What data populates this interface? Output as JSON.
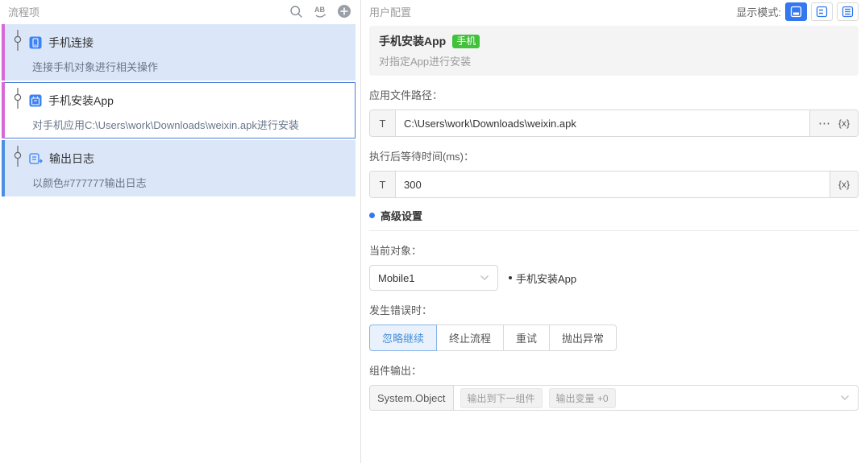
{
  "left_panel": {
    "title": "流程项",
    "items": [
      {
        "title": "手机连接",
        "desc": "连接手机对象进行相关操作",
        "bar_color": "#d46ad8",
        "selected": false
      },
      {
        "title": "手机安装App",
        "desc": "对手机应用C:\\Users\\work\\Downloads\\weixin.apk进行安装",
        "bar_color": "#d46ad8",
        "selected": true
      },
      {
        "title": "输出日志",
        "desc": "以颜色#777777输出日志",
        "bar_color": "#4a90e2",
        "selected": false
      }
    ]
  },
  "right_panel": {
    "title": "用户配置",
    "display_mode_label": "显示模式:",
    "info": {
      "title": "手机安装App",
      "badge": "手机",
      "badge_color": "#42c13a",
      "desc": "对指定App进行安装"
    },
    "fields": {
      "app_path": {
        "label": "应用文件路径：",
        "prefix": "T",
        "value": "C:\\Users\\work\\Downloads\\weixin.apk",
        "more": "⋯",
        "fx": "{x}"
      },
      "wait_time": {
        "label": "执行后等待时间(ms)：",
        "prefix": "T",
        "value": "300",
        "fx": "{x}"
      }
    },
    "advanced": {
      "section_title": "高级设置",
      "current_object_label": "当前对象：",
      "current_object_value": "Mobile1",
      "current_object_hint": "手机安装App",
      "on_error_label": "发生错误时：",
      "error_options": [
        {
          "label": "忽略继续",
          "selected": true
        },
        {
          "label": "终止流程",
          "selected": false
        },
        {
          "label": "重试",
          "selected": false
        },
        {
          "label": "抛出异常",
          "selected": false
        }
      ],
      "output_label": "组件输出：",
      "output_type": "System.Object",
      "output_tags": [
        "输出到下一组件",
        "输出变量 +0"
      ]
    },
    "icons": {
      "rename_label": "AB"
    }
  },
  "accent_colors": {
    "item_bg": "#dbe7f8",
    "selected_border": "#4a7edb",
    "active_mode_btn": "#3478f0",
    "green_badge": "#42c13a"
  }
}
